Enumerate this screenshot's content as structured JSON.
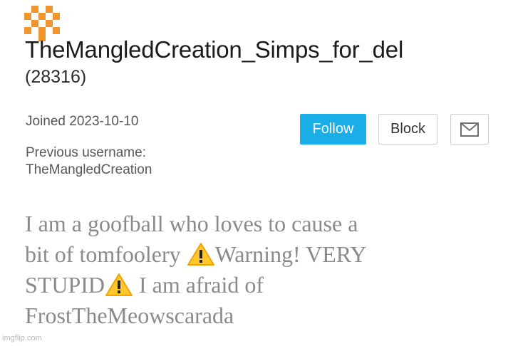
{
  "profile": {
    "username": "TheMangledCreation_Simps_for_del",
    "user_id": "(28316)",
    "joined": "Joined 2023-10-10",
    "previous_username_label": "Previous username:",
    "previous_username": "TheMangledCreation",
    "avatar_icon": "pixel-orange-avatar-icon",
    "avatar_color": "#f0962d"
  },
  "actions": {
    "follow_label": "Follow",
    "block_label": "Block",
    "message_icon": "mail-icon",
    "follow_color": "#1aaee8"
  },
  "bio": {
    "line1": "I am a goofball who loves to cause a",
    "line2_a": "bit of tomfoolery ",
    "line2_b": "Warning! VERY",
    "line3_a": "STUPID",
    "line3_b": " I am afraid of",
    "line4": "FrostTheMeowscarada",
    "warning_icon": "warning-emoji-icon"
  },
  "watermark": "imgflip.com"
}
